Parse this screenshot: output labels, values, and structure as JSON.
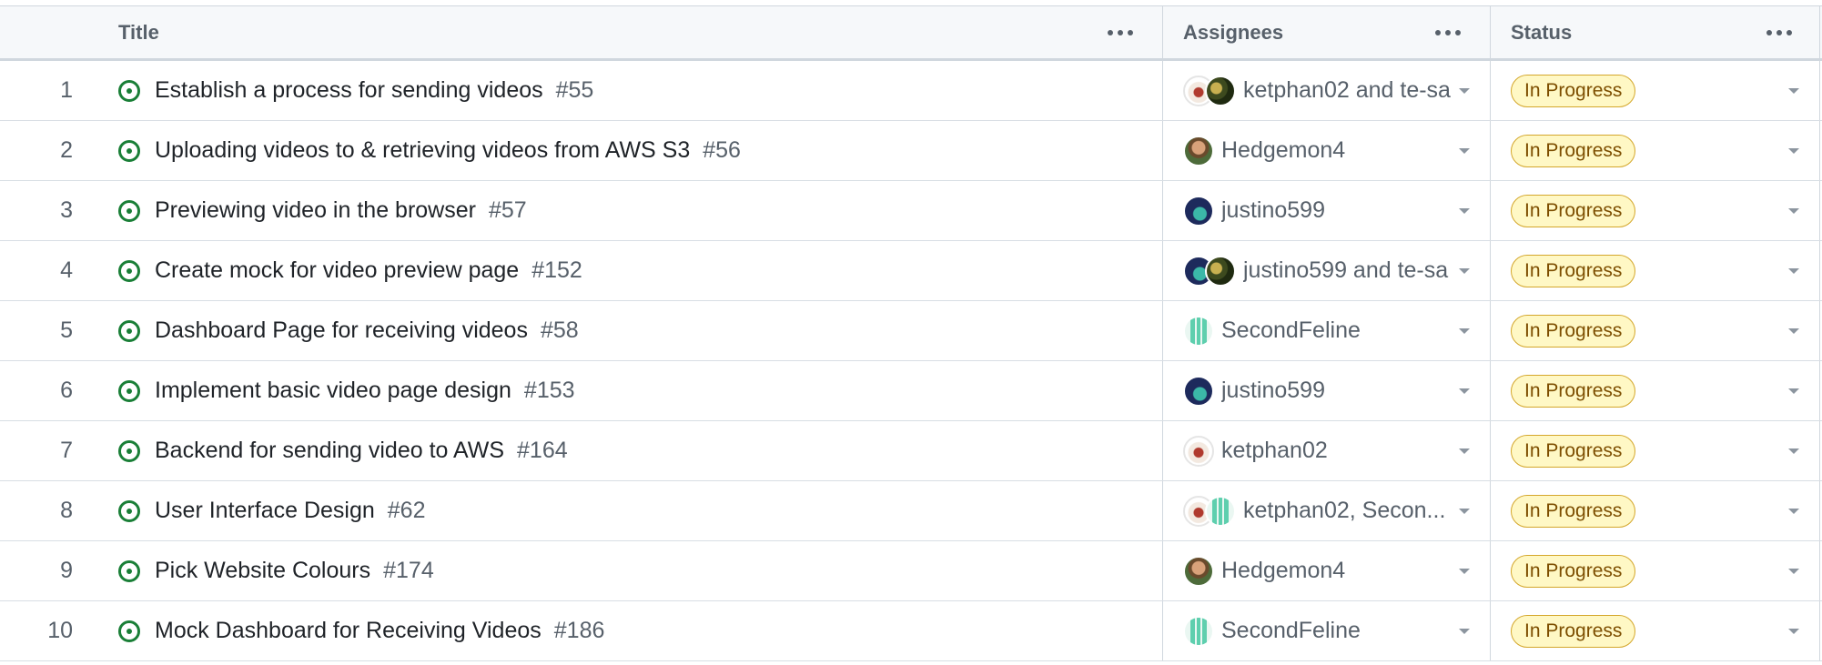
{
  "columns": {
    "title": "Title",
    "assignees": "Assignees",
    "status": "Status"
  },
  "colors": {
    "status_bg": "#fff8c5",
    "status_border": "#d4a72c",
    "issue_open": "#1a7f37"
  },
  "rows": [
    {
      "n": "1",
      "title": "Establish a process for sending videos",
      "issue": "#55",
      "avatars": [
        "ketphan02",
        "te-sa"
      ],
      "assignees": "ketphan02 and te-sa",
      "status": "In Progress"
    },
    {
      "n": "2",
      "title": "Uploading videos to & retrieving videos from AWS S3",
      "issue": "#56",
      "avatars": [
        "Hedgemon4"
      ],
      "assignees": "Hedgemon4",
      "status": "In Progress"
    },
    {
      "n": "3",
      "title": "Previewing video in the browser",
      "issue": "#57",
      "avatars": [
        "justino599"
      ],
      "assignees": "justino599",
      "status": "In Progress"
    },
    {
      "n": "4",
      "title": "Create mock for video preview page",
      "issue": "#152",
      "avatars": [
        "justino599",
        "te-sa"
      ],
      "assignees": "justino599 and te-sa",
      "status": "In Progress"
    },
    {
      "n": "5",
      "title": "Dashboard Page for receiving videos",
      "issue": "#58",
      "avatars": [
        "SecondFeline"
      ],
      "assignees": "SecondFeline",
      "status": "In Progress"
    },
    {
      "n": "6",
      "title": "Implement basic video page design",
      "issue": "#153",
      "avatars": [
        "justino599"
      ],
      "assignees": "justino599",
      "status": "In Progress"
    },
    {
      "n": "7",
      "title": "Backend for sending video to AWS",
      "issue": "#164",
      "avatars": [
        "ketphan02"
      ],
      "assignees": "ketphan02",
      "status": "In Progress"
    },
    {
      "n": "8",
      "title": "User Interface Design",
      "issue": "#62",
      "avatars": [
        "ketphan02",
        "SecondFeline"
      ],
      "assignees": "ketphan02, Secon...",
      "status": "In Progress"
    },
    {
      "n": "9",
      "title": "Pick Website Colours",
      "issue": "#174",
      "avatars": [
        "Hedgemon4"
      ],
      "assignees": "Hedgemon4",
      "status": "In Progress"
    },
    {
      "n": "10",
      "title": "Mock Dashboard for Receiving Videos",
      "issue": "#186",
      "avatars": [
        "SecondFeline"
      ],
      "assignees": "SecondFeline",
      "status": "In Progress"
    }
  ]
}
